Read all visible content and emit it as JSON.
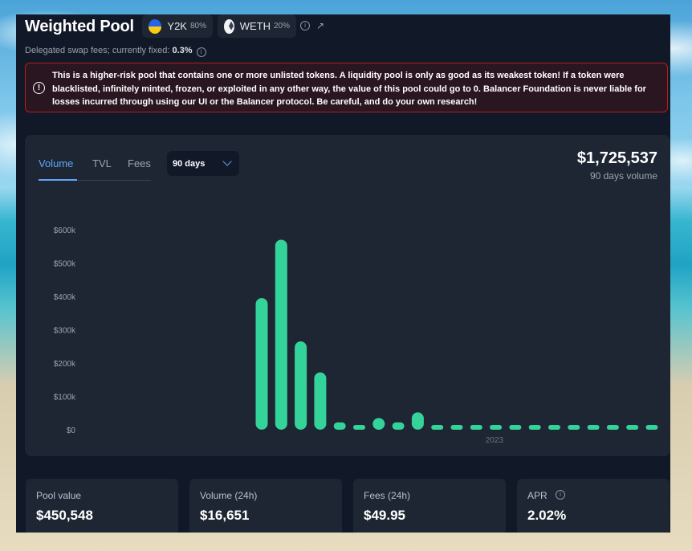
{
  "pool": {
    "title": "Weighted Pool",
    "tokens": [
      {
        "symbol": "Y2K",
        "weight": "80%",
        "icon": "y2k-token-icon"
      },
      {
        "symbol": "WETH",
        "weight": "20%",
        "icon": "weth-token-icon"
      }
    ],
    "fees_text": "Delegated swap fees; currently fixed:",
    "fees_value": "0.3%"
  },
  "warning": {
    "text": "This is a higher-risk pool that contains one or more unlisted tokens. A liquidity pool is only as good as its weakest token! If a token were blacklisted, infinitely minted, frozen, or exploited in any other way, the value of this pool could go to 0. Balancer Foundation is never liable for losses incurred through using our UI or the Balancer protocol. Be careful, and do your own research!"
  },
  "chart_panel": {
    "tabs": [
      "Volume",
      "TVL",
      "Fees"
    ],
    "active_tab": "Volume",
    "period": "90 days",
    "total": "$1,725,537",
    "total_label": "90 days volume",
    "accent": "#60a5fa",
    "bar_color": "#34d399"
  },
  "chart_data": {
    "type": "bar",
    "ylabel": "",
    "ylim": [
      0,
      600000
    ],
    "yticks": [
      "$0",
      "$100k",
      "$200k",
      "$300k",
      "$400k",
      "$500k",
      "$600k"
    ],
    "xticks": [
      "2023"
    ],
    "values": [
      395000,
      570000,
      265000,
      172000,
      22000,
      14000,
      35000,
      22000,
      52000,
      12000,
      10000,
      9000,
      5000,
      5000,
      4000,
      14000,
      7000,
      7000,
      3000,
      2000,
      3000
    ]
  },
  "stats": [
    {
      "label": "Pool value",
      "value": "$450,548"
    },
    {
      "label": "Volume (24h)",
      "value": "$16,651"
    },
    {
      "label": "Fees (24h)",
      "value": "$49.95"
    },
    {
      "label": "APR",
      "value": "2.02%"
    }
  ]
}
